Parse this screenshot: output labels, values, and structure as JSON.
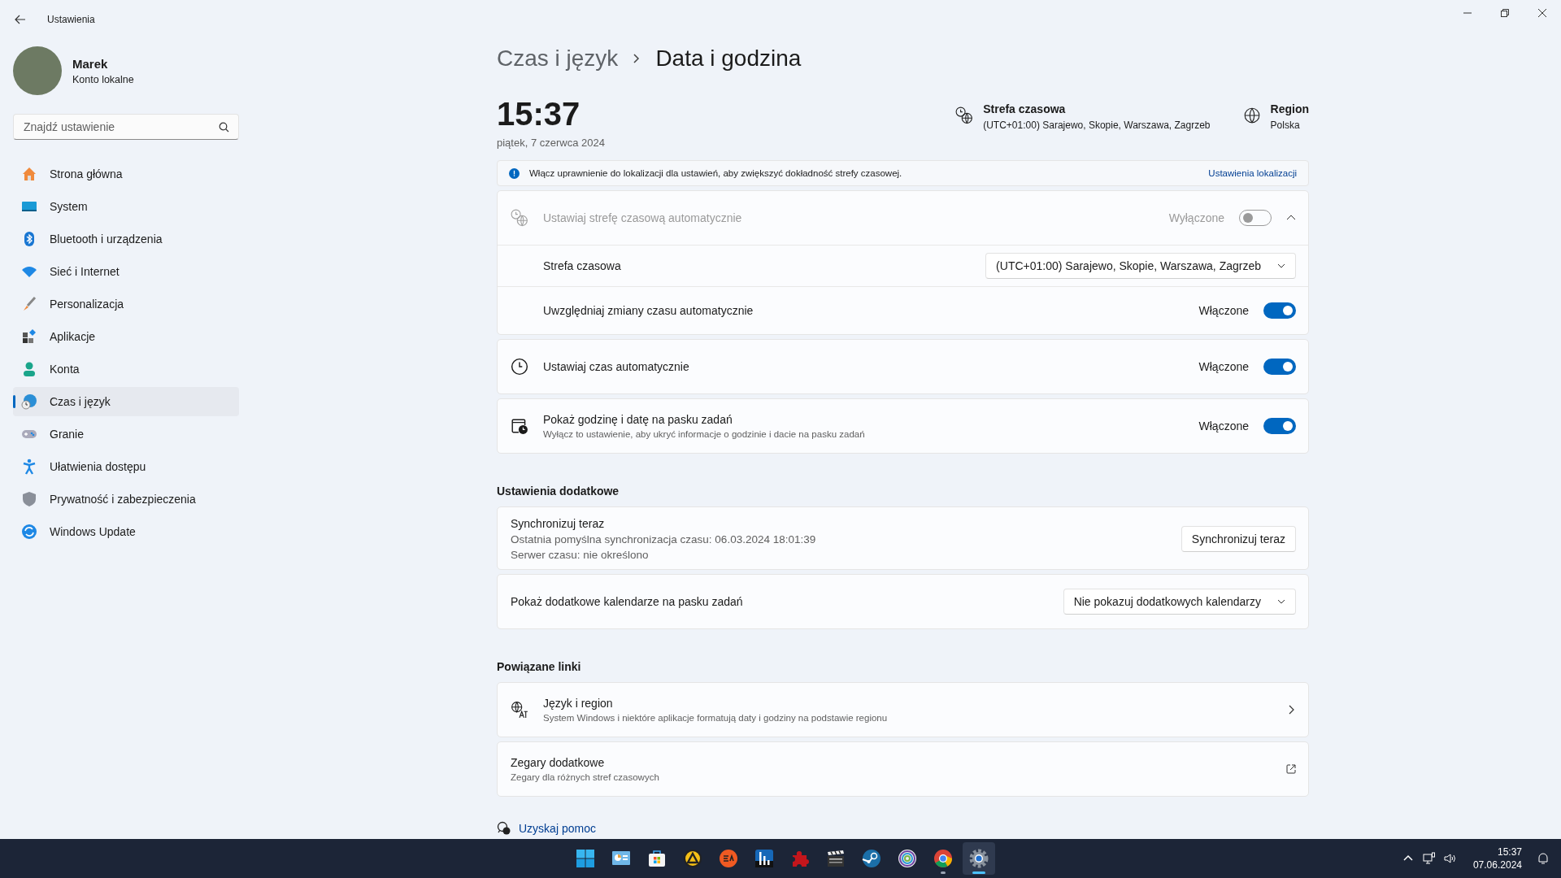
{
  "window": {
    "title": "Ustawienia"
  },
  "user": {
    "name": "Marek",
    "account": "Konto lokalne"
  },
  "search": {
    "placeholder": "Znajdź ustawienie"
  },
  "nav": [
    {
      "kind": "home",
      "label": "Strona główna",
      "selected": false
    },
    {
      "kind": "system",
      "label": "System",
      "selected": false
    },
    {
      "kind": "bluetooth",
      "label": "Bluetooth i urządzenia",
      "selected": false
    },
    {
      "kind": "wifi",
      "label": "Sieć i Internet",
      "selected": false
    },
    {
      "kind": "brush",
      "label": "Personalizacja",
      "selected": false
    },
    {
      "kind": "apps",
      "label": "Aplikacje",
      "selected": false
    },
    {
      "kind": "person",
      "label": "Konta",
      "selected": false
    },
    {
      "kind": "time",
      "label": "Czas i język",
      "selected": true
    },
    {
      "kind": "gamepad",
      "label": "Granie",
      "selected": false
    },
    {
      "kind": "accessibility",
      "label": "Ułatwienia dostępu",
      "selected": false
    },
    {
      "kind": "shield",
      "label": "Prywatność i zabezpieczenia",
      "selected": false
    },
    {
      "kind": "update",
      "label": "Windows Update",
      "selected": false
    }
  ],
  "breadcrumb": {
    "parent": "Czas i język",
    "current": "Data i godzina"
  },
  "clock": {
    "time": "15:37",
    "date": "piątek, 7 czerwca 2024"
  },
  "header_info": [
    {
      "kind": "timezone",
      "title": "Strefa czasowa",
      "value": "(UTC+01:00) Sarajewo, Skopie, Warszawa, Zagrzeb"
    },
    {
      "kind": "region",
      "title": "Region",
      "value": "Polska"
    }
  ],
  "banner": {
    "text": "Włącz uprawnienie do lokalizacji dla ustawień, aby zwiększyć dokładność strefy czasowej.",
    "link": "Ustawienia lokalizacji"
  },
  "settings": [
    {
      "kind": "expander",
      "label": "Ustawiaj strefę czasową automatycznie",
      "state_label": "Wyłączone",
      "on": false,
      "disabled": true,
      "expanded": true,
      "children": [
        {
          "kind": "dropdown",
          "label": "Strefa czasowa",
          "value": "(UTC+01:00) Sarajewo, Skopie, Warszawa, Zagrzeb"
        },
        {
          "kind": "toggle",
          "label": "Uwzględniaj zmiany czasu automatycznie",
          "state_label": "Włączone",
          "on": true,
          "disabled": false
        }
      ]
    },
    {
      "kind": "toggle",
      "label": "Ustawiaj czas automatycznie",
      "state_label": "Włączone",
      "on": true,
      "disabled": false
    },
    {
      "kind": "toggle",
      "label": "Pokaż godzinę i datę na pasku zadań",
      "description": "Wyłącz to ustawienie, aby ukryć informacje o godzinie i dacie na pasku zadań",
      "state_label": "Włączone",
      "on": true,
      "disabled": false
    }
  ],
  "additional": {
    "title": "Ustawienia dodatkowe",
    "items": [
      {
        "kind": "sync",
        "title": "Synchronizuj teraz",
        "lines": [
          "Ostatnia pomyślna synchronizacja czasu: 06.03.2024 18:01:39",
          "Serwer czasu: nie określono"
        ],
        "button": "Synchronizuj teraz"
      },
      {
        "kind": "dropdown",
        "label": "Pokaż dodatkowe kalendarze na pasku zadań",
        "value": "Nie pokazuj dodatkowych kalendarzy"
      }
    ]
  },
  "related": {
    "title": "Powiązane linki",
    "items": [
      {
        "kind": "chevron",
        "title": "Język i region",
        "description": "System Windows i niektóre aplikacje formatują daty i godziny na podstawie regionu"
      },
      {
        "kind": "external",
        "title": "Zegary dodatkowe",
        "description": "Zegary dla różnych stref czasowych"
      }
    ]
  },
  "help": {
    "label": "Uzyskaj pomoc"
  },
  "taskbar": {
    "apps": [
      {
        "kind": "start",
        "selected": false,
        "running": false
      },
      {
        "kind": "dashboard",
        "selected": false,
        "running": false
      },
      {
        "kind": "store",
        "selected": false,
        "running": false
      },
      {
        "kind": "triangle",
        "selected": false,
        "running": false
      },
      {
        "kind": "disc",
        "selected": false,
        "running": false
      },
      {
        "kind": "bars",
        "selected": false,
        "running": false
      },
      {
        "kind": "puzzle",
        "selected": false,
        "running": false
      },
      {
        "kind": "clapper",
        "selected": false,
        "running": false
      },
      {
        "kind": "steam",
        "selected": false,
        "running": false
      },
      {
        "kind": "swirl",
        "selected": false,
        "running": false
      },
      {
        "kind": "browser",
        "selected": false,
        "running": true
      },
      {
        "kind": "gear",
        "selected": true,
        "running": true
      }
    ],
    "time": "15:37",
    "date": "07.06.2024"
  }
}
